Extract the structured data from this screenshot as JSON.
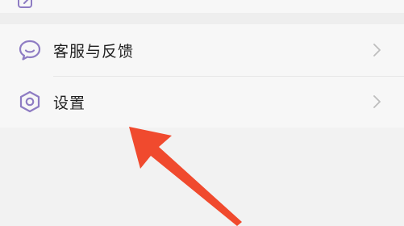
{
  "menu": {
    "items": [
      {
        "label": "客服与反馈",
        "icon": "chat-bubble-icon"
      },
      {
        "label": "设置",
        "icon": "settings-hexagon-icon"
      }
    ]
  },
  "colors": {
    "icon_purple": "#8e7cc3",
    "arrow_red": "#f04a2e",
    "chevron": "#bdbdbd"
  }
}
